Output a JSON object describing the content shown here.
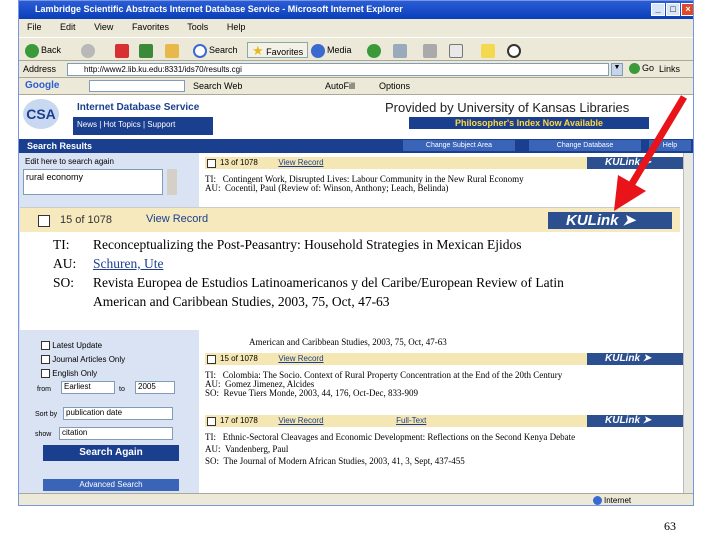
{
  "window": {
    "title": "Lambridge Scientific Abstracts Internet Database Service - Microsoft Internet Explorer",
    "menu": [
      "File",
      "Edit",
      "View",
      "Favorites",
      "Tools",
      "Help"
    ]
  },
  "toolbar": {
    "back": "Back",
    "search": "Search",
    "favorites": "Favorites",
    "media": "Media"
  },
  "address": {
    "label": "Address",
    "url": "http://www2.lib.ku.edu:8331/ids70/results.cgi",
    "go": "Go",
    "links": "Links"
  },
  "googlebar": {
    "logo": "Google",
    "search_web": "Search Web",
    "autofill": "AutoFill",
    "options": "Options"
  },
  "csa": {
    "logo": "CSA",
    "service": "Internet Database Service",
    "nav": [
      "News",
      "Hot Topics",
      "Support"
    ],
    "provided_by": "Provided by University of Kansas Libraries",
    "db_banner": "Philosopher's Index Now Available",
    "buttons": [
      "Change Subject Area",
      "Change Database",
      "Help"
    ]
  },
  "results": {
    "header": "Search Results",
    "search_hint": "Edit here to search again",
    "query": "rural economy",
    "options": [
      "Latest Update",
      "Journal Articles Only",
      "English Only"
    ],
    "from_label": "from",
    "from_value": "Earliest",
    "to_label": "to",
    "to_value": "2005",
    "sort_label": "Sort by",
    "sort_value": "publication date",
    "show_label": "show",
    "show_value": "citation",
    "search_again": "Search Again",
    "advanced": "Advanced Search"
  },
  "records": [
    {
      "num": "13 of 1078",
      "view": "View Record",
      "ti": "Contingent Work, Disrupted Lives: Labour Community in the New Rural Economy",
      "au": "Cocentil, Paul (Review of: Winson, Anthony; Leach, Belinda)"
    },
    {
      "num": "15 of 1078",
      "view": "View Record",
      "ti": "Colombia: The Socio. Context of Rural Property Concentration at the End of the 20th Century",
      "au": "Gomez Jimenez, Alcides",
      "so": "Revue Tiers Monde, 2003, 44, 176, Oct-Dec, 833-909"
    },
    {
      "num": "17 of 1078",
      "view": "View Record",
      "full": "Full-Text",
      "ti": "Ethnic-Sectoral Cleavages and Economic Development: Reflections on the Second Kenya Debate",
      "au": "Vandenberg, Paul",
      "so": "The Journal of Modern African Studies, 2003, 41, 3, Sept, 437-455"
    }
  ],
  "behind_text": "American and Caribbean Studies, 2003, 75, Oct, 47-63",
  "kulink": "KULink",
  "zoom": {
    "num": "15 of 1078",
    "view": "View Record",
    "ti_label": "TI:",
    "ti": "Reconceptualizing the Post-Peasantry: Household Strategies in Mexican Ejidos",
    "au_label": "AU:",
    "au": "Schuren, Ute",
    "so_label": "SO:",
    "so1": "Revista Europea de Estudios Latinoamericanos y del Caribe/European Review of Latin",
    "so2": "American and Caribbean Studies, 2003, 75, Oct, 47-63"
  },
  "status": "Internet",
  "page_number": "63",
  "colors": {
    "arrow": "#e8141a",
    "title_bar": "#0a3fb8",
    "header_bar": "#1b3f8f",
    "record_head": "#f5e7b4"
  }
}
